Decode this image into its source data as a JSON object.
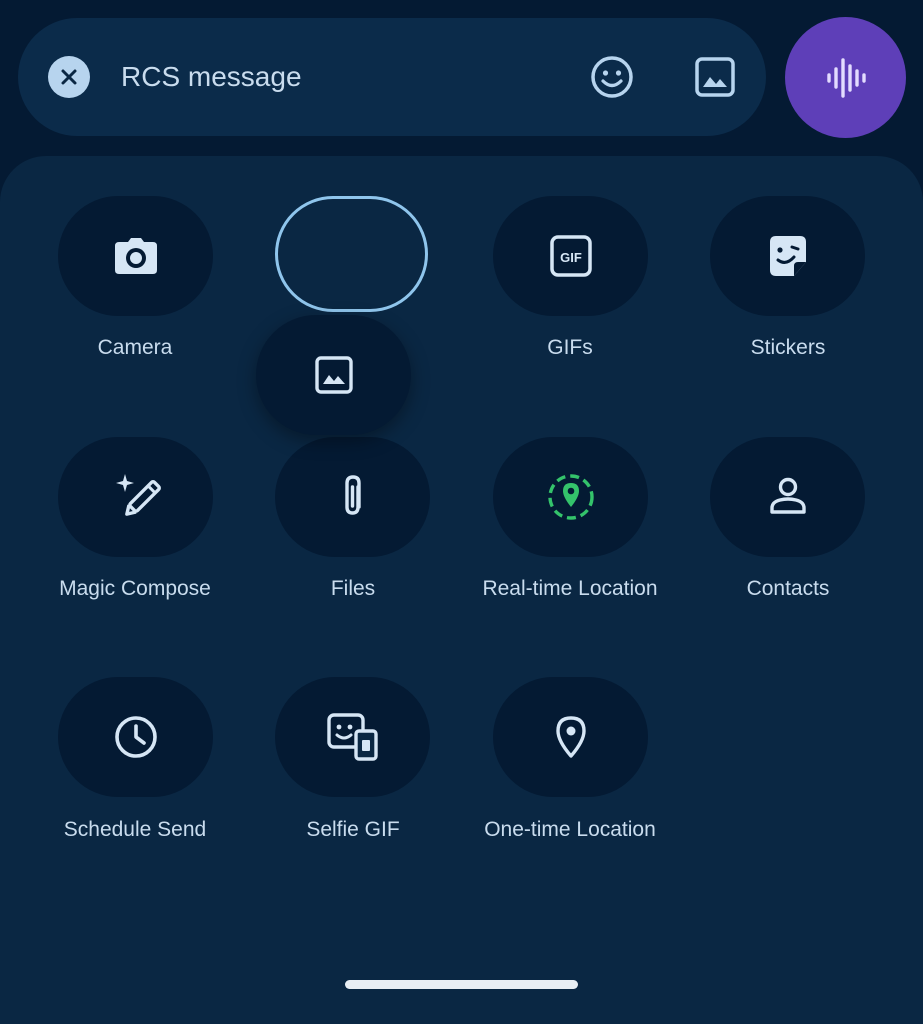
{
  "compose": {
    "placeholder": "RCS message",
    "icons": {
      "close": "close-icon",
      "emoji": "emoji-icon",
      "gallery": "gallery-icon",
      "voice": "voice-waveform-icon"
    }
  },
  "attachments": {
    "items": [
      {
        "label": "Camera",
        "icon": "camera-icon"
      },
      {
        "label": "",
        "icon": "gallery-icon",
        "state": "being dragged"
      },
      {
        "label": "GIFs",
        "icon": "gif-icon"
      },
      {
        "label": "Stickers",
        "icon": "sticker-icon"
      },
      {
        "label": "Magic Compose",
        "icon": "magic-pen-icon"
      },
      {
        "label": "Files",
        "icon": "paperclip-icon"
      },
      {
        "label": "Real-time Location",
        "icon": "realtime-location-icon"
      },
      {
        "label": "Contacts",
        "icon": "contact-icon"
      },
      {
        "label": "Schedule Send",
        "icon": "clock-icon"
      },
      {
        "label": "Selfie GIF",
        "icon": "selfie-gif-icon"
      },
      {
        "label": "One-time Location",
        "icon": "location-pin-icon"
      }
    ]
  },
  "colors": {
    "background": "#041a33",
    "panel": "#0a2743",
    "accent_voice": "#5e3fb8",
    "location_green": "#34c36b",
    "icon": "#d6e6f5",
    "label": "#c9dcee",
    "drag_outline": "#8fc5ec"
  }
}
